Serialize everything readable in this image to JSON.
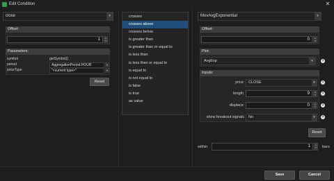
{
  "window": {
    "title": "Edit Condition",
    "close_glyph": "✕"
  },
  "left": {
    "study_select": "close",
    "offset": {
      "label": "Offset:",
      "value": "1"
    },
    "parameters": {
      "label": "Parameters:",
      "rows": [
        {
          "name": "symbol",
          "value": "getSymbol()"
        },
        {
          "name": "period",
          "value": "AggregationPeriod.HOUR"
        },
        {
          "name": "priceType",
          "value": "\"<current type>\""
        }
      ]
    },
    "reset_label": "Reset"
  },
  "middle": {
    "items": [
      {
        "label": "crosses",
        "selected": false
      },
      {
        "label": "crosses above",
        "selected": true
      },
      {
        "label": "crosses below",
        "selected": false
      },
      {
        "label": "is greater than",
        "selected": false
      },
      {
        "label": "is greater than or equal to",
        "selected": false
      },
      {
        "label": "is less than",
        "selected": false
      },
      {
        "label": "is less than or equal to",
        "selected": false
      },
      {
        "label": "is equal to",
        "selected": false
      },
      {
        "label": "is not equal to",
        "selected": false
      },
      {
        "label": "is false",
        "selected": false
      },
      {
        "label": "is true",
        "selected": false
      },
      {
        "label": "as value",
        "selected": false
      }
    ]
  },
  "right": {
    "study_select": "MovAvgExponential",
    "offset": {
      "label": "Offset:",
      "value": "0"
    },
    "plot": {
      "label": "Plot:",
      "value": "AvgExp"
    },
    "inputs": {
      "label": "Inputs:",
      "price": {
        "label": "price",
        "value": "CLOSE"
      },
      "length": {
        "label": "length",
        "value": "9"
      },
      "displace": {
        "label": "displace",
        "value": "0"
      },
      "breakout": {
        "label": "show breakout signals",
        "value": "No"
      }
    },
    "reset_label": "Reset",
    "within": {
      "label": "within",
      "value": "1",
      "unit": "bars"
    }
  },
  "footer": {
    "save_label": "Save",
    "cancel_label": "Cancel"
  },
  "glyphs": {
    "dropdown": "▾",
    "spin_up": "▲",
    "spin_down": "▼",
    "help": "?"
  },
  "colors": {
    "selected_item": "#1e4e79",
    "app_icon": "#2e9e4a"
  }
}
